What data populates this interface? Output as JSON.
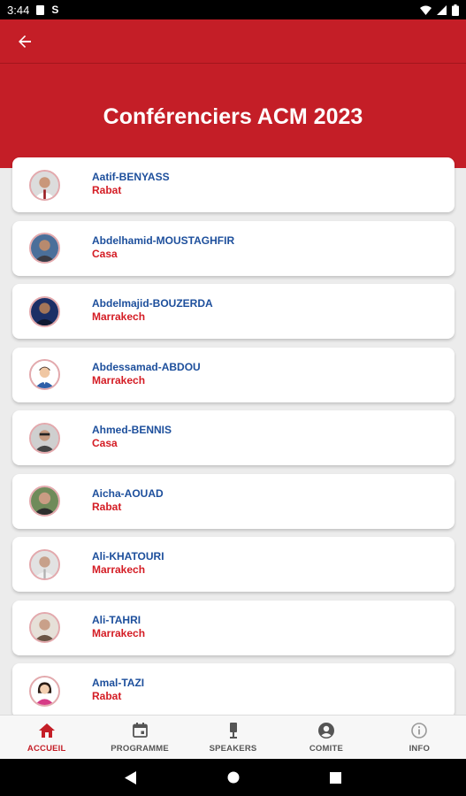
{
  "status_bar": {
    "time": "3:44",
    "s_letter": "S"
  },
  "header": {
    "title": "Conférenciers ACM 2023"
  },
  "speakers": [
    {
      "name": "Aatif-BENYASS",
      "city": "Rabat"
    },
    {
      "name": "Abdelhamid-MOUSTAGHFIR",
      "city": "Casa"
    },
    {
      "name": "Abdelmajid-BOUZERDA",
      "city": "Marrakech"
    },
    {
      "name": "Abdessamad-ABDOU",
      "city": "Marrakech"
    },
    {
      "name": "Ahmed-BENNIS",
      "city": "Casa"
    },
    {
      "name": "Aicha-AOUAD",
      "city": "Rabat"
    },
    {
      "name": "Ali-KHATOURI",
      "city": "Marrakech"
    },
    {
      "name": "Ali-TAHRI",
      "city": "Marrakech"
    },
    {
      "name": "Amal-TAZI",
      "city": "Rabat"
    }
  ],
  "bottom_nav": [
    {
      "label": "ACCUEIL",
      "icon": "home-icon",
      "active": true
    },
    {
      "label": "PROGRAMME",
      "icon": "calendar-icon",
      "active": false
    },
    {
      "label": "SPEAKERS",
      "icon": "microphone-icon",
      "active": false
    },
    {
      "label": "COMITE",
      "icon": "account-circle-icon",
      "active": false
    },
    {
      "label": "INFO",
      "icon": "info-icon",
      "active": false
    }
  ],
  "colors": {
    "primary": "#c41e27",
    "name": "#1d4f9c",
    "city": "#d41c24"
  }
}
